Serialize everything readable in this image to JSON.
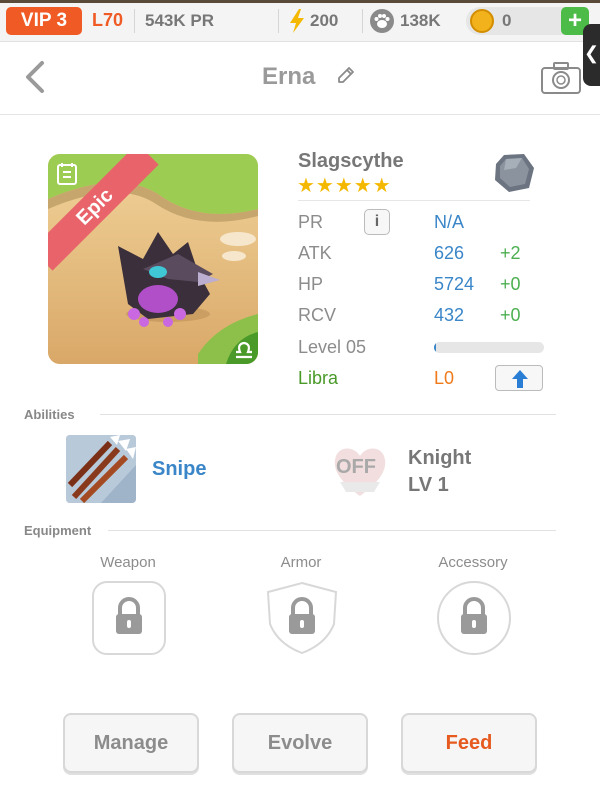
{
  "topbar": {
    "vip": "VIP 3",
    "level": "L70",
    "power_rating": "543K PR",
    "energy": "200",
    "food": "138K",
    "gold": "0",
    "add_label": "+",
    "side_tab_label": "❮"
  },
  "header": {
    "title": "Erna"
  },
  "monster": {
    "rarity": "Epic",
    "name": "Slagscythe",
    "stars": "★★★★★",
    "star_count": 5,
    "element": "Libra"
  },
  "stats": {
    "pr": {
      "label": "PR",
      "info": "i",
      "value": "N/A"
    },
    "atk": {
      "label": "ATK",
      "value": "626",
      "bonus": "+2"
    },
    "hp": {
      "label": "HP",
      "value": "5724",
      "bonus": "+0"
    },
    "rcv": {
      "label": "RCV",
      "value": "432",
      "bonus": "+0"
    },
    "level": {
      "label": "Level 05",
      "xp_progress": 0.02
    },
    "sign": {
      "label": "Libra",
      "value": "L0"
    }
  },
  "abilities": {
    "heading": "Abilities",
    "skill": "Snipe",
    "off_label": "OFF",
    "class_name": "Knight",
    "class_level": "LV 1"
  },
  "equipment": {
    "heading": "Equipment",
    "slots": [
      {
        "label": "Weapon"
      },
      {
        "label": "Armor"
      },
      {
        "label": "Accessory"
      }
    ]
  },
  "actions": {
    "manage": "Manage",
    "evolve": "Evolve",
    "feed": "Feed"
  },
  "colors": {
    "accent_orange": "#f05a24",
    "stat_blue": "#3a86c8",
    "bonus_green": "#4caf50",
    "epic_red": "#e8646a"
  }
}
